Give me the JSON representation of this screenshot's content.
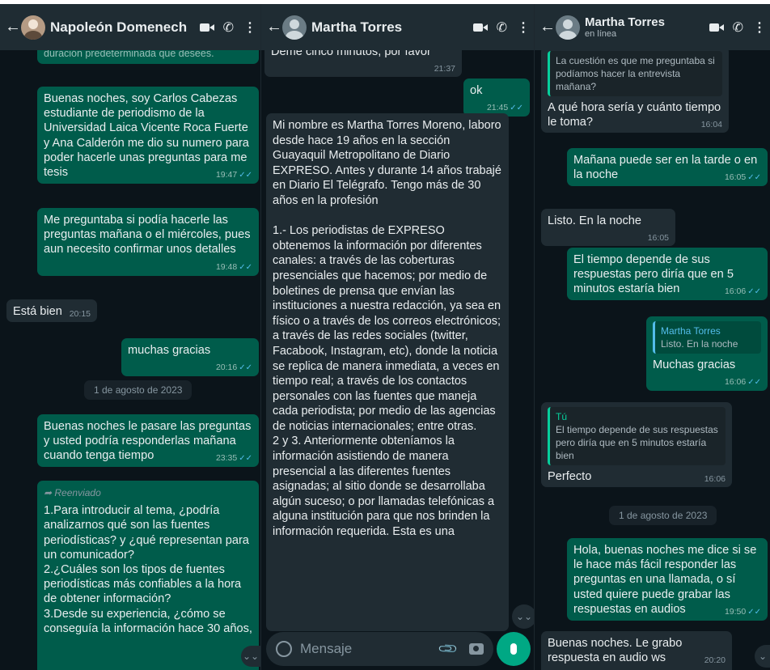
{
  "panel1": {
    "contact_name": "Napoleón Domenech",
    "msg_top_fragment": "duración predeterminada que desees.",
    "messages": [
      {
        "text": "Buenas noches, soy Carlos Cabezas estudiante de periodismo de la Universidad Laica Vicente Roca Fuerte y Ana Calderón me dio su numero para poder hacerle unas preguntas para me tesis",
        "time": "19:47"
      },
      {
        "text": "Me preguntaba si podía hacerle las preguntas mañana o el miércoles, pues aun necesito confirmar unos detalles",
        "time": "19:48"
      },
      {
        "text": "Está bien",
        "time": "20:15"
      },
      {
        "text": "muchas gracias",
        "time": "20:16"
      },
      {
        "text": "Buenas noches le pasare las preguntas y usted podría responderlas mañana cuando tenga tiempo",
        "time": "23:35"
      }
    ],
    "date_label": "1 de agosto de 2023",
    "forwarded_label": "Reenviado",
    "forwarded_text": "1.Para introducir al tema, ¿podría analizarnos qué son las fuentes periodísticas? y ¿qué representan para un comunicador?\n2.¿Cuáles son los tipos de fuentes periodísticas más confiables a la hora de obtener información?\n3.Desde su experiencia, ¿cómo se conseguía la información hace 30 años,"
  },
  "panel2": {
    "contact_name": "Martha Torres",
    "msg_top": {
      "text": "Deme cinco minutos, por favor",
      "time": "21:37"
    },
    "msg_ok": {
      "text": "ok",
      "time": "21:45"
    },
    "long_message": "Mi nombre es Martha Torres Moreno, laboro desde hace 19 años en la sección Guayaquil Metropolitano de Diario EXPRESO. Antes y durante 14 años trabajé en Diario El Telégrafo. Tengo más de 30 años en la profesión\n\n1.- Los periodistas de EXPRESO obtenemos la información por diferentes canales: a través de las coberturas presenciales que hacemos; por medio de boletines de prensa que envían las instituciones a nuestra redacción, ya sea en físico o a través de los correos electrónicos; a través de las redes sociales (twitter, Facabook, Instagram, etc), donde la noticia se replica de manera inmediata, a veces en tiempo real; a través de los contactos personales con las fuentes que maneja cada periodista; por medio de las agencias de noticias internacionales; entre otras.\n2 y 3.  Anteriormente obteníamos la información asistiendo de manera presencial a las diferentes fuentes asignadas; al sitio donde se desarrollaba algún suceso; o por llamadas telefónicas a alguna institución para que nos brinden la información requerida. Esta es una",
    "composer_placeholder": "Mensaje"
  },
  "panel3": {
    "contact_name": "Martha Torres",
    "status": "en línea",
    "messages": [
      {
        "quote": "La cuestión es que me preguntaba si podíamos hacer la entrevista mañana?",
        "text": "A qué hora sería y cuánto tiempo le toma?",
        "time": "16:04"
      },
      {
        "text": "Mañana puede ser en la tarde o en la noche",
        "time": "16:05"
      },
      {
        "text": "Listo. En la noche",
        "time": "16:05"
      },
      {
        "text": "El tiempo depende de sus respuestas pero diría que en 5 minutos estaría bien",
        "time": "16:06"
      },
      {
        "quote_name": "Martha Torres",
        "quote": "Listo. En la noche",
        "text": "Muchas gracias",
        "time": "16:06"
      },
      {
        "quote_name": "Tú",
        "quote": "El tiempo depende de sus respuestas pero diría que en 5 minutos estaría bien",
        "text": "Perfecto",
        "time": "16:06"
      },
      {
        "text": "Hola, buenas noches me dice si se le hace más fácil responder las preguntas en una llamada, o sí usted quiere puede grabar las respuestas en audios",
        "time": "19:50"
      },
      {
        "text": "Buenas noches. Le grabo respuesta en audio ws",
        "time": "20:20"
      }
    ],
    "date_label": "1 de agosto de 2023"
  }
}
